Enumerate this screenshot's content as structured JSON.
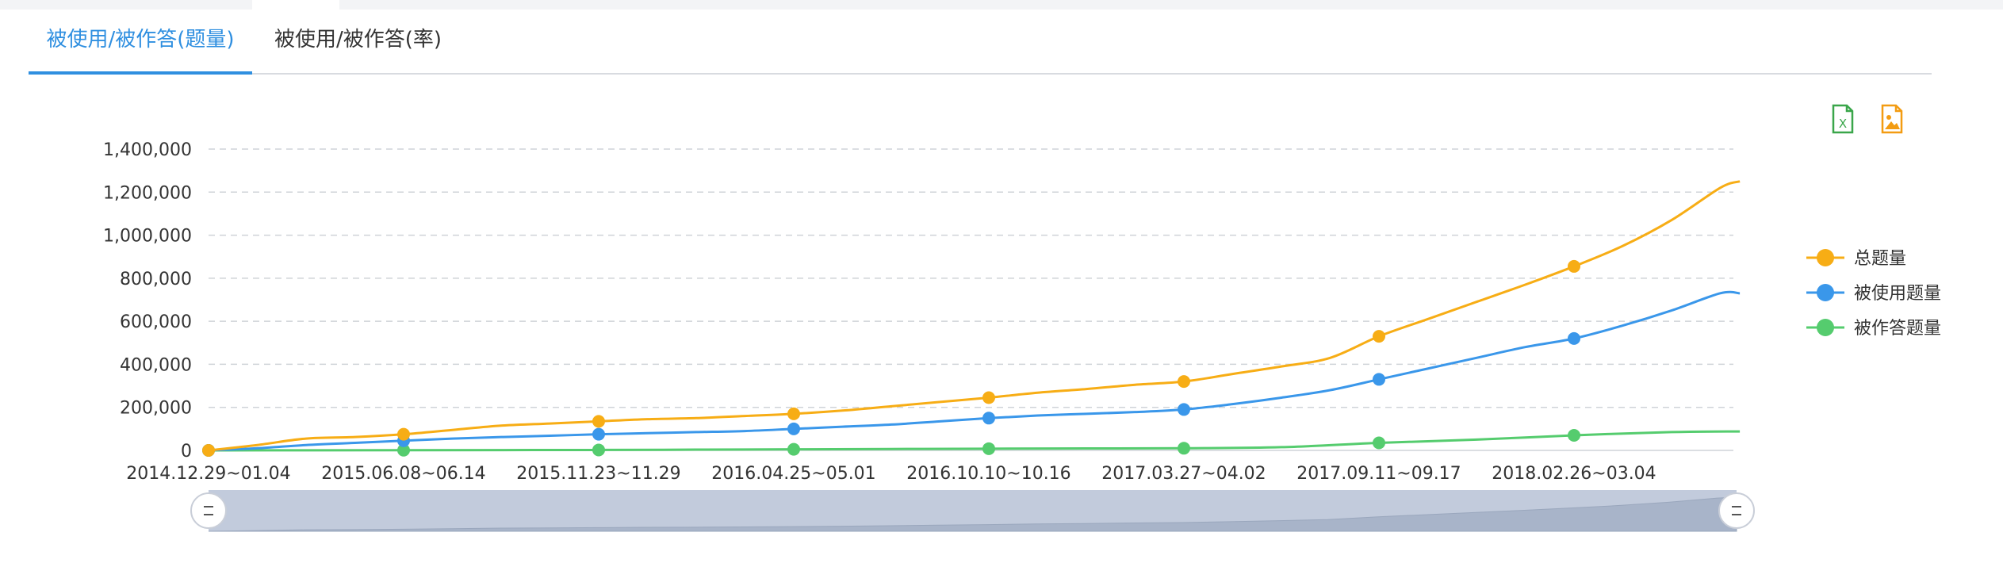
{
  "tabs": [
    {
      "label": "被使用/被作答(题量)",
      "active": true
    },
    {
      "label": "被使用/被作答(率)",
      "active": false
    }
  ],
  "toolbox": {
    "export_excel_icon": "excel-export-icon",
    "save_image_icon": "image-save-icon"
  },
  "colors": {
    "accent": "#2f8fe0",
    "series": [
      "#f7ad15",
      "#3a97ea",
      "#55cc6e"
    ]
  },
  "chart_data": {
    "type": "line",
    "x_ticks": [
      "2014.12.29~01.04",
      "2015.06.08~06.14",
      "2015.11.23~11.29",
      "2016.04.25~05.01",
      "2016.10.10~10.16",
      "2017.03.27~04.02",
      "2017.09.11~09.17",
      "2018.02.26~03.04"
    ],
    "y_ticks": [
      "0",
      "200,000",
      "400,000",
      "600,000",
      "800,000",
      "1,000,000",
      "1,200,000",
      "1,400,000"
    ],
    "ylim": [
      0,
      1400000
    ],
    "grid": true,
    "legend_position": "right",
    "series": [
      {
        "name": "总题量",
        "color": "#f7ad15",
        "x": [
          0,
          0.25,
          0.5,
          0.75,
          1,
          1.25,
          1.5,
          1.75,
          2,
          2.25,
          2.5,
          2.75,
          3,
          3.25,
          3.5,
          3.75,
          4,
          4.25,
          4.5,
          4.75,
          5,
          5.25,
          5.5,
          5.75,
          6,
          6.25,
          6.5,
          6.75,
          7,
          7.25,
          7.5,
          7.75,
          7.85
        ],
        "values": [
          0,
          25000,
          55000,
          62000,
          75000,
          95000,
          115000,
          125000,
          135000,
          145000,
          150000,
          160000,
          170000,
          185000,
          205000,
          225000,
          245000,
          268000,
          285000,
          305000,
          320000,
          355000,
          390000,
          430000,
          530000,
          610000,
          690000,
          770000,
          855000,
          950000,
          1070000,
          1220000,
          1250000
        ],
        "markers": [
          0,
          1,
          2,
          3,
          4,
          5,
          6,
          7
        ]
      },
      {
        "name": "被使用题量",
        "color": "#3a97ea",
        "x": [
          0,
          0.25,
          0.5,
          0.75,
          1,
          1.25,
          1.5,
          1.75,
          2,
          2.25,
          2.5,
          2.75,
          3,
          3.25,
          3.5,
          3.75,
          4,
          4.25,
          4.5,
          4.75,
          5,
          5.25,
          5.5,
          5.75,
          6,
          6.25,
          6.5,
          6.75,
          7,
          7.25,
          7.5,
          7.75,
          7.85
        ],
        "values": [
          0,
          10000,
          25000,
          35000,
          45000,
          55000,
          62000,
          68000,
          75000,
          80000,
          85000,
          90000,
          100000,
          110000,
          120000,
          135000,
          150000,
          162000,
          170000,
          178000,
          190000,
          215000,
          245000,
          280000,
          330000,
          380000,
          430000,
          480000,
          520000,
          580000,
          650000,
          730000,
          730000
        ],
        "markers": [
          0,
          1,
          2,
          3,
          4,
          5,
          6,
          7
        ]
      },
      {
        "name": "被作答题量",
        "color": "#55cc6e",
        "x": [
          0,
          0.5,
          1,
          1.5,
          2,
          2.5,
          3,
          3.5,
          4,
          4.5,
          5,
          5.5,
          6,
          6.5,
          7,
          7.5,
          7.85
        ],
        "values": [
          0,
          500,
          1000,
          1500,
          2000,
          3500,
          5000,
          6500,
          8000,
          9000,
          10000,
          15000,
          35000,
          50000,
          70000,
          85000,
          88000
        ],
        "markers": [
          0,
          1,
          2,
          3,
          4,
          5,
          6,
          7
        ]
      }
    ],
    "data_zoom": {
      "start_label": "2014.12.29~01.04",
      "end_label": "2018.02.26~03.04"
    }
  }
}
